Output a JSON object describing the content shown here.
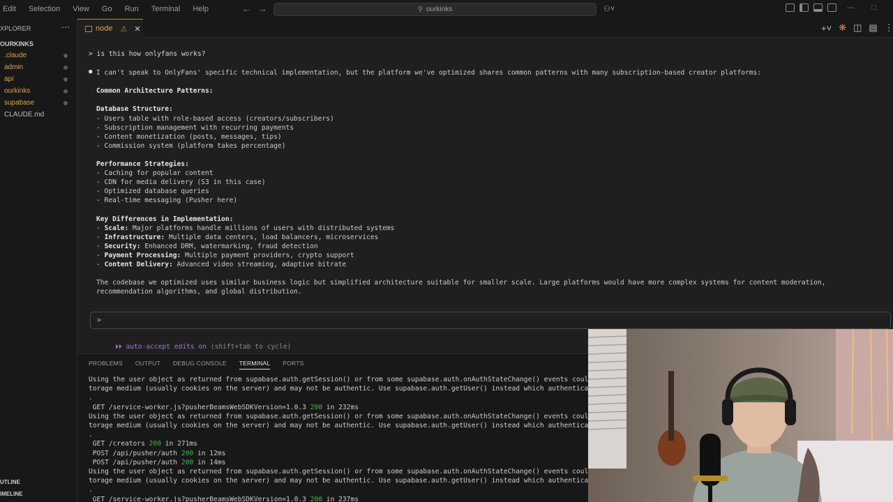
{
  "menu": [
    "Edit",
    "Selection",
    "View",
    "Go",
    "Run",
    "Terminal",
    "Help"
  ],
  "search": {
    "text": "ourkinks"
  },
  "sidebar": {
    "header": "XPLORER",
    "root": "OURKINKS",
    "items": [
      {
        "label": ".claude",
        "color": "#d8a54a",
        "dot": true
      },
      {
        "label": "admin",
        "color": "#d8a54a",
        "dot": true
      },
      {
        "label": "api",
        "color": "#d8a54a",
        "dot": true
      },
      {
        "label": "ourkinks",
        "color": "#d8a54a",
        "dot": true
      },
      {
        "label": "supabase",
        "color": "#d8a54a",
        "dot": true
      },
      {
        "label": "CLAUDE.md",
        "color": "#bbbbbb",
        "dot": false
      }
    ],
    "outline": "UTLINE",
    "timeline": "IMELINE"
  },
  "tab": {
    "label": "node"
  },
  "claude": {
    "prompt": "> is this how onlyfans works?",
    "lines": [
      "I can't speak to OnlyFans' specific technical implementation, but the platform we've optimized shares common patterns with many subscription-based creator platforms:",
      "",
      "Common Architecture Patterns:",
      "",
      "Database Structure:",
      "- Users table with role-based access (creators/subscribers)",
      "- Subscription management with recurring payments",
      "- Content monetization (posts, messages, tips)",
      "- Commission system (platform takes percentage)",
      "",
      "Performance Strategies:",
      "- Caching for popular content",
      "- CDN for media delivery (S3 in this case)",
      "- Optimized database queries",
      "- Real-time messaging (Pusher here)",
      "",
      "Key Differences in Implementation:",
      "- Scale: Major platforms handle millions of users with distributed systems",
      "- Infrastructure: Multiple data centers, load balancers, microservices",
      "- Security: Enhanced DRM, watermarking, fraud detection",
      "- Payment Processing: Multiple payment providers, crypto support",
      "- Content Delivery: Advanced video streaming, adaptive bitrate",
      "",
      "The codebase we optimized uses similar business logic but simplified architecture suitable for smaller scale. Large platforms would have more complex systems for content moderation,",
      "recommendation algorithms, and global distribution."
    ],
    "input_prompt": ">",
    "autoaccept_a": "⏵⏵ auto-accept edits on",
    "autoaccept_b": " (shift+tab to cycle)"
  },
  "panel": {
    "tabs": [
      "PROBLEMS",
      "OUTPUT",
      "DEBUG CONSOLE",
      "TERMINAL",
      "PORTS"
    ],
    "lines": [
      {
        "pre": "Using the user object as returned from supabase.auth.getSession() or from some supabase.auth.onAuthStateChange() events coul",
        "status": "",
        "post": ""
      },
      {
        "pre": "torage medium (usually cookies on the server) and may not be authentic. Use supabase.auth.getUser() instead which authentica",
        "status": "",
        "post": ""
      },
      {
        "pre": ".",
        "status": "",
        "post": ""
      },
      {
        "pre": " GET /service-worker.js?pusherBeamsWebSDKVersion=1.0.3 ",
        "status": "200",
        "post": " in 232ms"
      },
      {
        "pre": "Using the user object as returned from supabase.auth.getSession() or from some supabase.auth.onAuthStateChange() events coul",
        "status": "",
        "post": ""
      },
      {
        "pre": "torage medium (usually cookies on the server) and may not be authentic. Use supabase.auth.getUser() instead which authentica",
        "status": "",
        "post": ""
      },
      {
        "pre": ".",
        "status": "",
        "post": ""
      },
      {
        "pre": " GET /creators ",
        "status": "200",
        "post": " in 271ms"
      },
      {
        "pre": " POST /api/pusher/auth ",
        "status": "200",
        "post": " in 12ms"
      },
      {
        "pre": " POST /api/pusher/auth ",
        "status": "200",
        "post": " in 14ms"
      },
      {
        "pre": "Using the user object as returned from supabase.auth.getSession() or from some supabase.auth.onAuthStateChange() events coul",
        "status": "",
        "post": ""
      },
      {
        "pre": "torage medium (usually cookies on the server) and may not be authentic. Use supabase.auth.getUser() instead which authentica",
        "status": "",
        "post": ""
      },
      {
        "pre": ".",
        "status": "",
        "post": ""
      },
      {
        "pre": " GET /service-worker.js?pusherBeamsWebSDKVersion=1.0.3 ",
        "status": "200",
        "post": " in 237ms"
      }
    ]
  },
  "colors": {
    "accent": "#d18616",
    "success": "#3fb950",
    "autoaccept": "#a672d8"
  }
}
